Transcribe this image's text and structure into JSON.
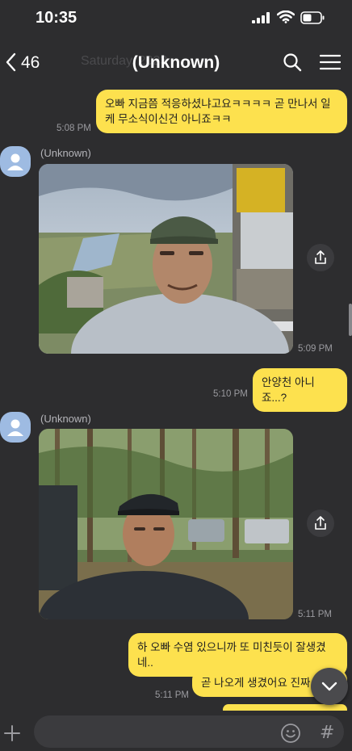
{
  "status": {
    "time": "10:35"
  },
  "header": {
    "back_count": "46",
    "title": "(Unknown)",
    "background_text": "Saturday, 2023"
  },
  "messages": [
    {
      "type": "outgoing",
      "text": "오빠 지금쯤 적응하셨냐고요ㅋㅋㅋㅋ 곧 만나서 일케 무소식이신건 아니죠ㅋㅋ",
      "time": "5:08 PM"
    },
    {
      "type": "incoming-photo",
      "sender": "(Unknown)",
      "time": "5:09 PM"
    },
    {
      "type": "outgoing",
      "text": "안양천 아니죠...?",
      "time": "5:10 PM"
    },
    {
      "type": "incoming-photo",
      "sender": "(Unknown)",
      "time": "5:11 PM"
    },
    {
      "type": "outgoing",
      "text": "하 오빠 수염 있으니까 또 미친듯이 잘생겼네..",
      "time": ""
    },
    {
      "type": "outgoing",
      "text": "곧 나오게 생겼어요 진짜ㅋㅋ",
      "time": "5:11 PM"
    }
  ],
  "input": {
    "placeholder": ""
  },
  "colors": {
    "background": "#2d2d2f",
    "outgoing_bubble": "#fde14e",
    "avatar": "#9ebbe2"
  },
  "icons": [
    "signal-icon",
    "wifi-icon",
    "battery-icon",
    "back-chevron-icon",
    "search-icon",
    "menu-icon",
    "share-icon",
    "chevron-down-icon",
    "plus-icon",
    "emoji-icon",
    "hash-icon"
  ]
}
